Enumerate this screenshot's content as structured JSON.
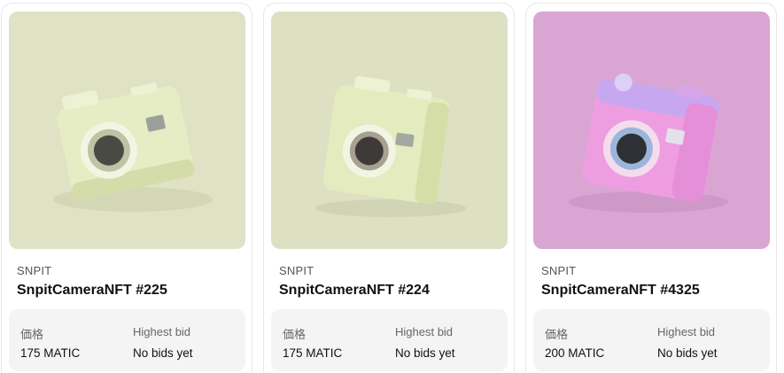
{
  "cards": [
    {
      "collection": "SNPIT",
      "name": "SnpitCameraNFT #225",
      "price_label": "価格",
      "price_value": "175 MATIC",
      "bid_label": "Highest bid",
      "bid_value": "No bids yet",
      "bg_color": "#dfe2c4",
      "camera_color": "#e6ecc4"
    },
    {
      "collection": "SNPIT",
      "name": "SnpitCameraNFT #224",
      "price_label": "価格",
      "price_value": "175 MATIC",
      "bid_label": "Highest bid",
      "bid_value": "No bids yet",
      "bg_color": "#dde0c2",
      "camera_color": "#e4ebbf"
    },
    {
      "collection": "SNPIT",
      "name": "SnpitCameraNFT #4325",
      "price_label": "価格",
      "price_value": "200 MATIC",
      "bid_label": "Highest bid",
      "bid_value": "No bids yet",
      "bg_color": "#d9a6d3",
      "camera_color": "#ee9ee0"
    }
  ]
}
